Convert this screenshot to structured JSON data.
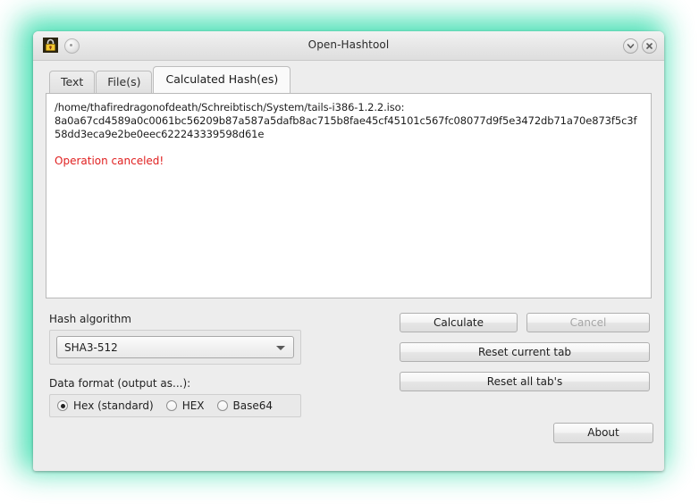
{
  "window": {
    "title": "Open-Hashtool",
    "icons": {
      "app": "lock-icon",
      "rollup": "rollup-button-icon",
      "shade": "chevron-down-icon",
      "close": "close-icon"
    }
  },
  "tabs": [
    {
      "label": "Text",
      "active": false
    },
    {
      "label": "File(s)",
      "active": false
    },
    {
      "label": "Calculated Hash(es)",
      "active": true
    }
  ],
  "output": {
    "hash_text": "/home/thafiredragonofdeath/Schreibtisch/System/tails-i386-1.2.2.iso:\n8a0a67cd4589a0c0061bc56209b87a587a5dafb8ac715b8fae45cf45101c567fc08077d9f5e3472db71a70e873f5c3f58dd3eca9e2be0eec622243339598d61e",
    "file_path": "/home/thafiredragonofdeath/Schreibtisch/System/tails-i386-1.2.2.iso:",
    "hash_value": "8a0a67cd4589a0c0061bc56209b87a587a5dafb8ac715b8fae45cf45101c567fc08077d9f5e3472db71a70e873f5c3f58dd3eca9e2be0eec622243339598d61e",
    "status_message": "Operation canceled!",
    "status_color": "#e02020"
  },
  "algorithm": {
    "label": "Hash algorithm",
    "selected": "SHA3-512",
    "arrow_icon": "chevron-down-icon"
  },
  "format": {
    "label": "Data format (output as...):",
    "options": [
      {
        "label": "Hex (standard)",
        "checked": true
      },
      {
        "label": "HEX",
        "checked": false
      },
      {
        "label": "Base64",
        "checked": false
      }
    ]
  },
  "buttons": {
    "calculate": "Calculate",
    "cancel": "Cancel",
    "cancel_disabled": true,
    "reset_current": "Reset current tab",
    "reset_all": "Reset all tab's",
    "about": "About"
  },
  "colors": {
    "glow": "#43dfb2",
    "window_bg": "#ededed",
    "panel_bg": "#ffffff",
    "error": "#e02020"
  }
}
